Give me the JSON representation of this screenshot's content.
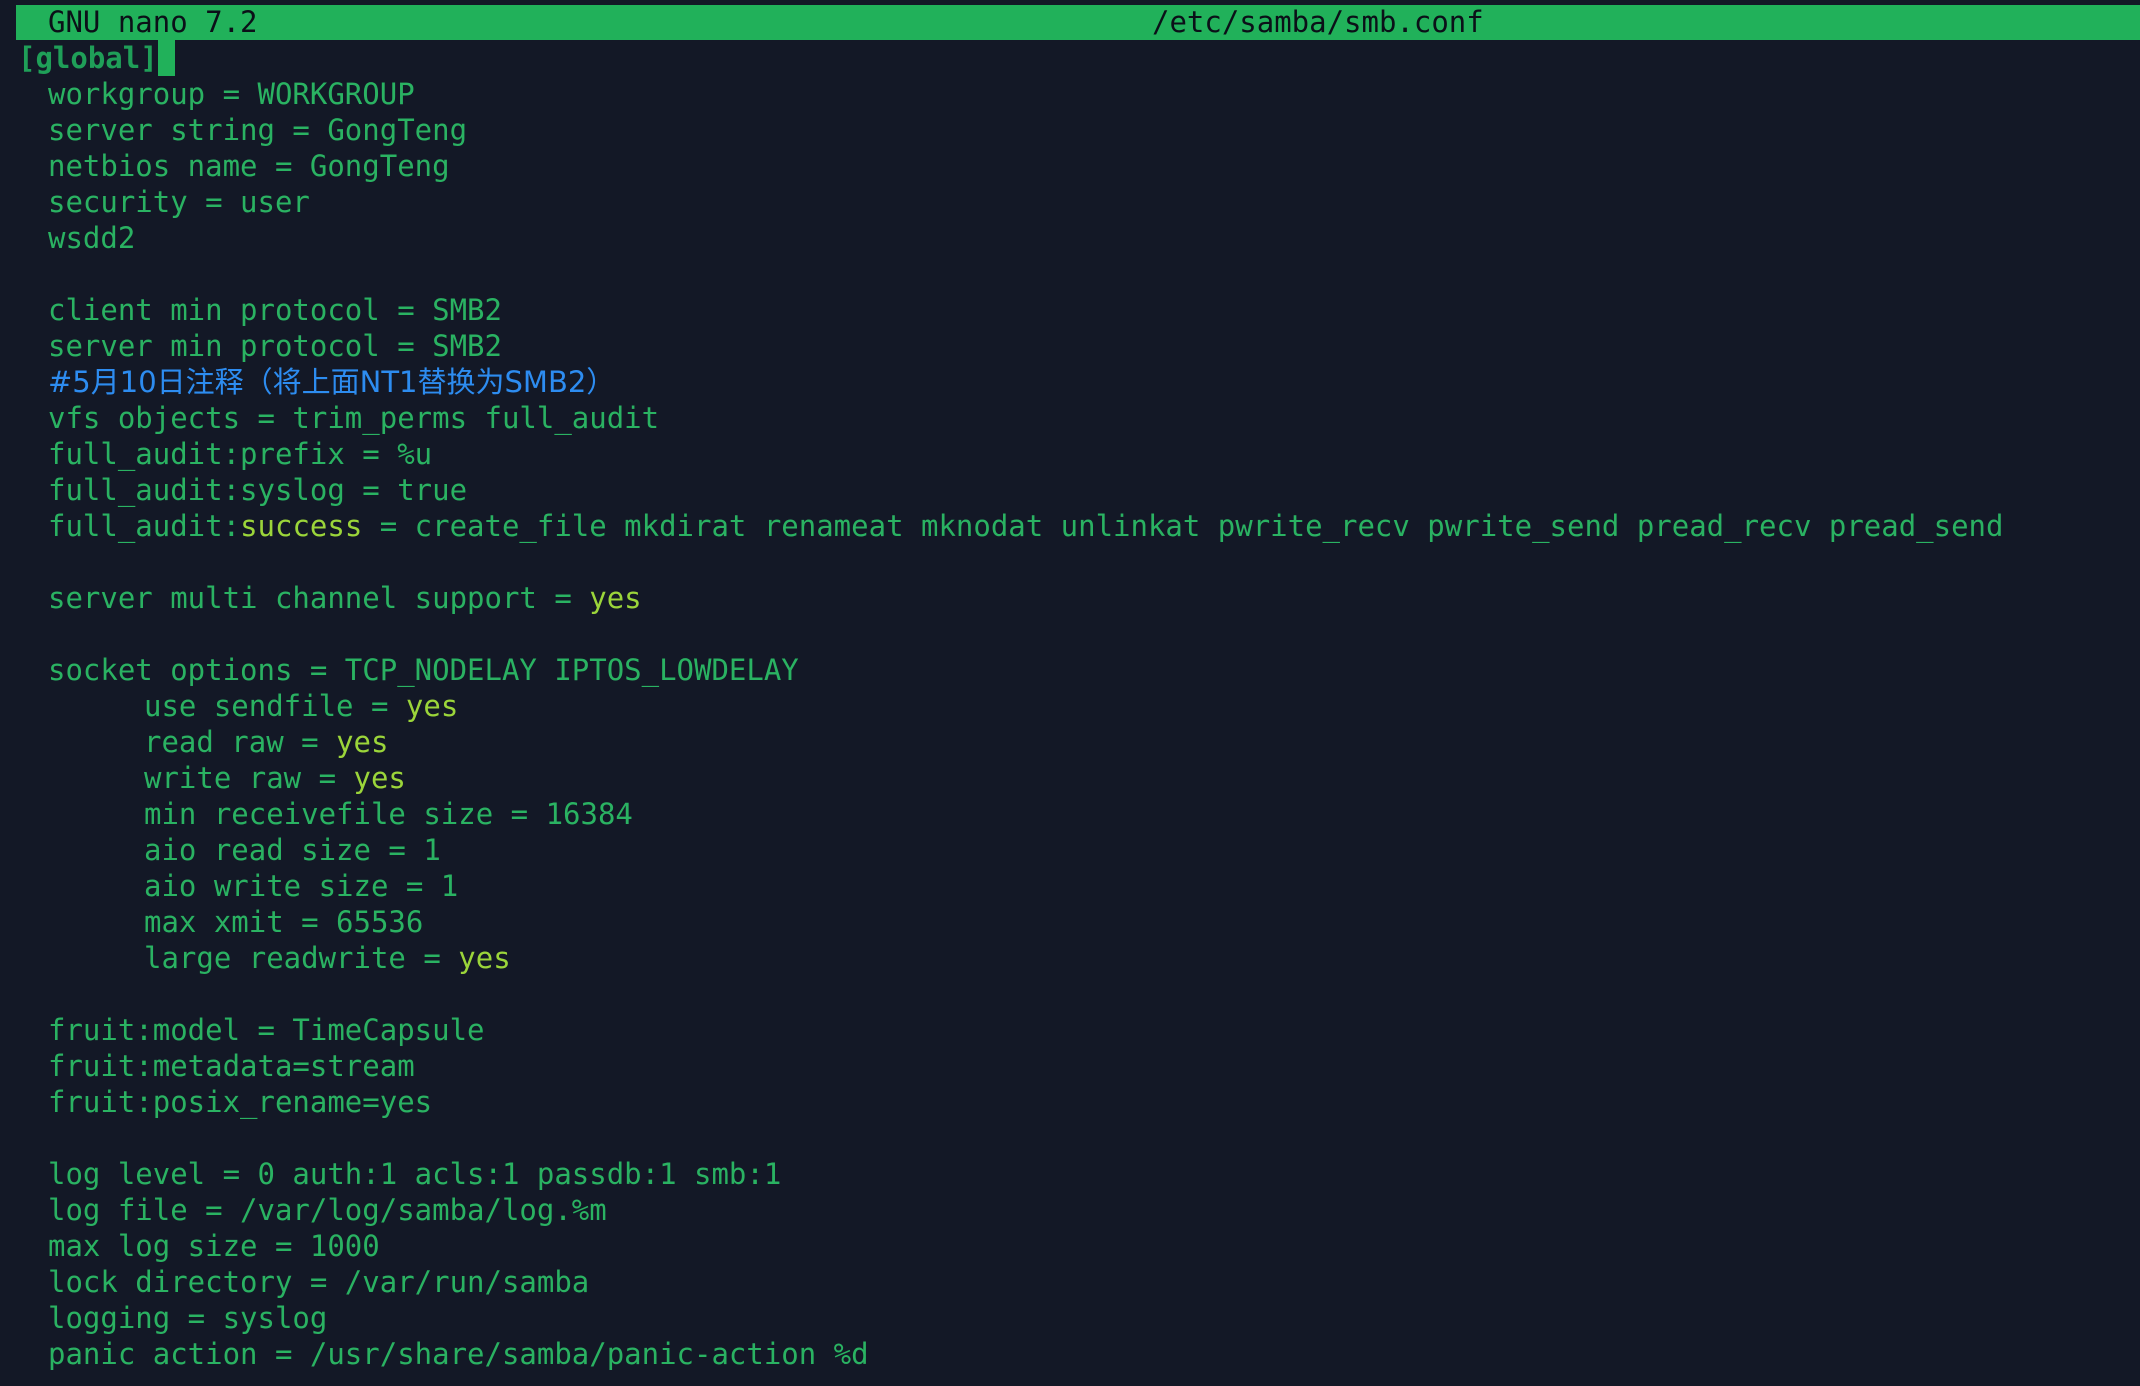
{
  "titlebar": {
    "app": "GNU nano 7.2",
    "file": "/etc/samba/smb.conf"
  },
  "lines": {
    "section": "[global]",
    "workgroup": "workgroup = WORKGROUP",
    "server_string": "server string = GongTeng",
    "netbios_name": "netbios name = GongTeng",
    "security": "security = user",
    "wsdd2": "wsdd2",
    "client_min": "client min protocol = SMB2",
    "server_min": "server min protocol = SMB2",
    "comment": "#5月10日注释（将上面NT1替换为SMB2）",
    "vfs_objects": "vfs objects = trim_perms full_audit",
    "audit_prefix": "full_audit:prefix = %u",
    "audit_syslog": "full_audit:syslog = true",
    "audit_success_key": "full_audit:",
    "audit_success_kw": "success",
    "audit_success_rest": " = create_file mkdirat renameat mknodat unlinkat pwrite_recv pwrite_send pread_recv pread_send",
    "multichannel_key": "server multi channel support = ",
    "multichannel_val": "yes",
    "socket_options": "socket options = TCP_NODELAY IPTOS_LOWDELAY",
    "use_sendfile_key": "use sendfile = ",
    "use_sendfile_val": "yes",
    "read_raw_key": "read raw = ",
    "read_raw_val": "yes",
    "write_raw_key": "write raw = ",
    "write_raw_val": "yes",
    "min_receivefile": "min receivefile size = 16384",
    "aio_read": "aio read size = 1",
    "aio_write": "aio write size = 1",
    "max_xmit": "max xmit = 65536",
    "large_rw_key": "large readwrite = ",
    "large_rw_val": "yes",
    "fruit_model": "fruit:model = TimeCapsule",
    "fruit_metadata": "fruit:metadata=stream",
    "fruit_posix": "fruit:posix_rename=yes",
    "log_level": "log level = 0 auth:1 acls:1 passdb:1 smb:1",
    "log_file": "log file = /var/log/samba/log.%m",
    "max_log_size": "max log size = 1000",
    "lock_directory": "lock directory = /var/run/samba",
    "logging": "logging = syslog",
    "panic_action": "panic action = /usr/share/samba/panic-action %d"
  },
  "colors": {
    "background": "#131826",
    "text": "#2ab262",
    "titlebar": "#21b15a",
    "comment": "#2d8cf0",
    "keyword": "#9bd53a"
  }
}
